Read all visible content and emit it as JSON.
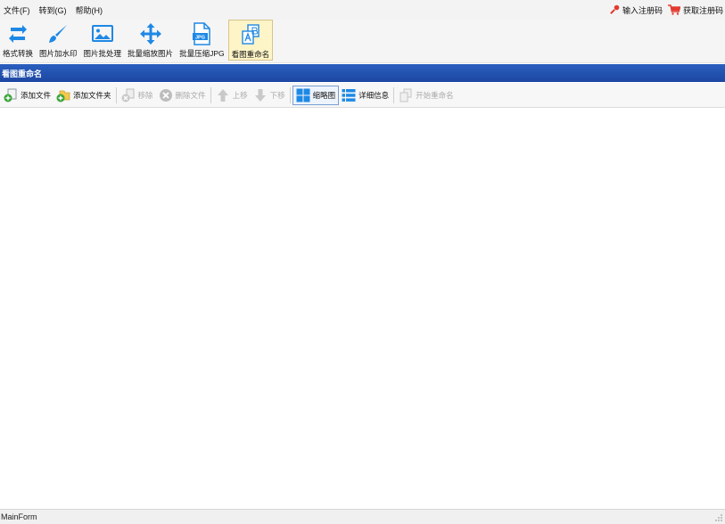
{
  "menu": {
    "items": [
      "文件(F)",
      "转到(G)",
      "帮助(H)"
    ],
    "enter_code": "输入注册码",
    "get_code": "获取注册码"
  },
  "toolbar": {
    "buttons": [
      {
        "label": "格式转换",
        "icon": "format-convert-icon"
      },
      {
        "label": "图片加水印",
        "icon": "brush-icon"
      },
      {
        "label": "图片批处理",
        "icon": "image-icon"
      },
      {
        "label": "批量缩放图片",
        "icon": "move-arrows-icon"
      },
      {
        "label": "批量压缩JPG",
        "icon": "jpg-file-icon"
      },
      {
        "label": "看图重命名",
        "icon": "rename-icon"
      }
    ],
    "active_index": 5,
    "jpg_badge": "JPG"
  },
  "panel_title": "看图重命名",
  "subtoolbar": {
    "add_file": "添加文件",
    "add_folder": "添加文件夹",
    "remove": "移除",
    "delete_file": "删除文件",
    "move_up": "上移",
    "move_down": "下移",
    "thumbnail": "缩略图",
    "details": "详细信息",
    "start_rename": "开始重命名"
  },
  "status": {
    "text": "MainForm"
  },
  "colors": {
    "accent_blue": "#1e88e5",
    "title_bar": "#1c46a1",
    "active_bg": "#fdf4c7"
  }
}
